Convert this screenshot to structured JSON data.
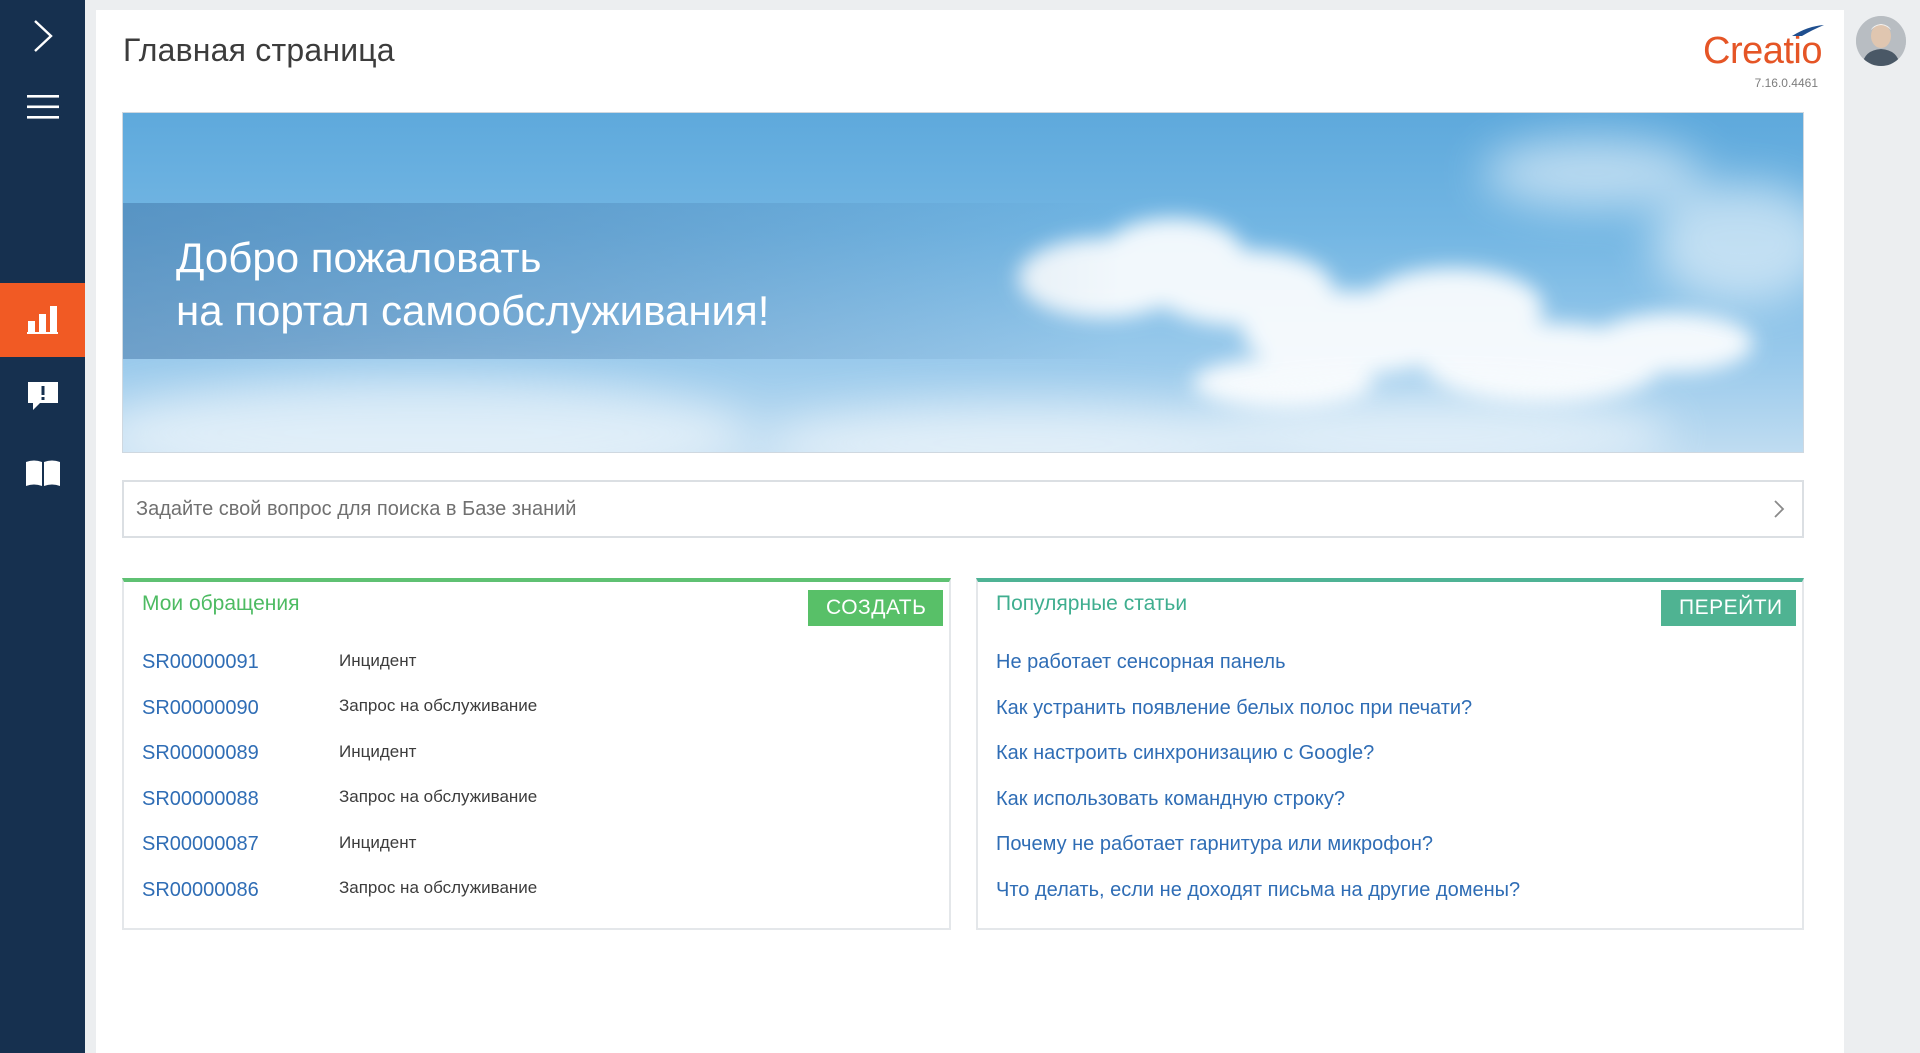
{
  "sidebar": {
    "items": [
      {
        "name": "expand",
        "icon": "chevron-right-icon"
      },
      {
        "name": "menu",
        "icon": "hamburger-menu-icon"
      },
      {
        "name": "dashboard",
        "icon": "bar-chart-icon",
        "active": true
      },
      {
        "name": "cases",
        "icon": "alert-message-icon"
      },
      {
        "name": "knowledge-base",
        "icon": "open-book-icon"
      }
    ],
    "background_color": "#16304f",
    "active_color": "#f15a24"
  },
  "header": {
    "title": "Главная страница",
    "brand": "Creatio",
    "version": "7.16.0.4461"
  },
  "banner": {
    "line1": "Добро пожаловать",
    "line2": "на портал самообслуживания!"
  },
  "search": {
    "placeholder": "Задайте свой вопрос для поиска в Базе знаний",
    "value": ""
  },
  "cases_panel": {
    "title": "Мои обращения",
    "button_label": "СОЗДАТЬ",
    "accent_color": "#5fc173",
    "rows": [
      {
        "number": "SR00000091",
        "type": "Инцидент"
      },
      {
        "number": "SR00000090",
        "type": "Запрос на обслуживание"
      },
      {
        "number": "SR00000089",
        "type": "Инцидент"
      },
      {
        "number": "SR00000088",
        "type": "Запрос на обслуживание"
      },
      {
        "number": "SR00000087",
        "type": "Инцидент"
      },
      {
        "number": "SR00000086",
        "type": "Запрос на обслуживание"
      }
    ]
  },
  "articles_panel": {
    "title": "Популярные статьи",
    "button_label": "ПЕРЕЙТИ",
    "accent_color": "#4fb395",
    "items": [
      "Не работает сенсорная панель",
      "Как устранить появление белых полос при печати?",
      "Как настроить синхронизацию с Google?",
      "Как использовать командную строку?",
      "Почему не работает гарнитура или микрофон?",
      "Что делать, если не доходят письма на другие домены?"
    ]
  },
  "user": {
    "avatar_icon": "user-avatar-icon"
  }
}
